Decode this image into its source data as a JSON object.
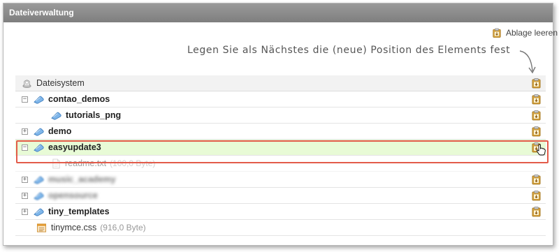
{
  "window": {
    "title": "Dateiverwaltung"
  },
  "toolbar": {
    "clear_clipboard": "Ablage leeren"
  },
  "annotation": {
    "text": "Legen Sie als Nächstes die (neue) Position des Elements fest"
  },
  "tree": {
    "root": {
      "label": "Dateisystem"
    },
    "rows": [
      {
        "label": "contao_demos",
        "toggle": "−"
      },
      {
        "label": "tutorials_png"
      },
      {
        "label": "demo",
        "toggle": "+"
      },
      {
        "label": "easyupdate3",
        "toggle": "−"
      },
      {
        "label": "readme.txt",
        "meta": "(100,0 Byte)"
      },
      {
        "label": "music_academy",
        "toggle": "+"
      },
      {
        "label": "opensource",
        "toggle": "+"
      },
      {
        "label": "tiny_templates",
        "toggle": "+"
      },
      {
        "label": "tinymce.css",
        "meta": "(916,0 Byte)"
      }
    ]
  },
  "icons": {
    "clipboard": "clipboard-icon",
    "paste_into": "paste-into-icon",
    "folder": "folder-icon",
    "file": "file-icon",
    "css_file": "css-file-icon",
    "filesystem": "filesystem-icon",
    "hand_cursor": "hand-cursor-icon"
  },
  "colors": {
    "highlight_row": "#e8fbd6",
    "selection_border": "#e35b4a",
    "titlebar": "#8a8a8a"
  }
}
